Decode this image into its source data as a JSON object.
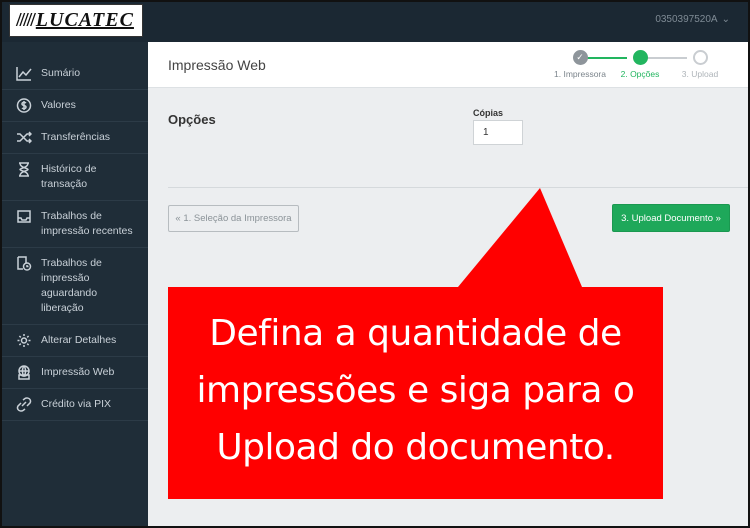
{
  "brand": {
    "logo_text": "LUCATEC"
  },
  "topbar": {
    "user": "0350397520A",
    "chevron": "⌄"
  },
  "sidebar": {
    "items": [
      {
        "label": "Sumário",
        "icon": "chart-line-icon"
      },
      {
        "label": "Valores",
        "icon": "dollar-circle-icon"
      },
      {
        "label": "Transferências",
        "icon": "shuffle-icon"
      },
      {
        "label": "Histórico de transação",
        "icon": "hourglass-icon"
      },
      {
        "label": "Trabalhos de impressão recentes",
        "icon": "inbox-icon"
      },
      {
        "label": "Trabalhos de impressão aguardando liberação",
        "icon": "document-clock-icon"
      },
      {
        "label": "Alterar Detalhes",
        "icon": "gear-icon"
      },
      {
        "label": "Impressão Web",
        "icon": "printer-web-icon"
      },
      {
        "label": "Crédito via PIX",
        "icon": "link-icon"
      }
    ]
  },
  "header": {
    "title": "Impressão Web"
  },
  "steps": [
    {
      "label": "1. Impressora",
      "state": "done",
      "check": "✓"
    },
    {
      "label": "2. Opções",
      "state": "current"
    },
    {
      "label": "3. Upload",
      "state": "pending"
    }
  ],
  "form": {
    "section_title": "Opções",
    "copies_label": "Cópias",
    "copies_value": "1"
  },
  "buttons": {
    "back": "« 1. Seleção da Impressora",
    "next": "3. Upload Documento »"
  },
  "callout": {
    "lines": [
      "Defina a quantidade de",
      "impressões e siga para o",
      "Upload do documento."
    ],
    "color": "#ff0000"
  },
  "colors": {
    "accent": "#22b55f",
    "sidebar": "#1f2d38",
    "topbar": "#1b2833"
  }
}
